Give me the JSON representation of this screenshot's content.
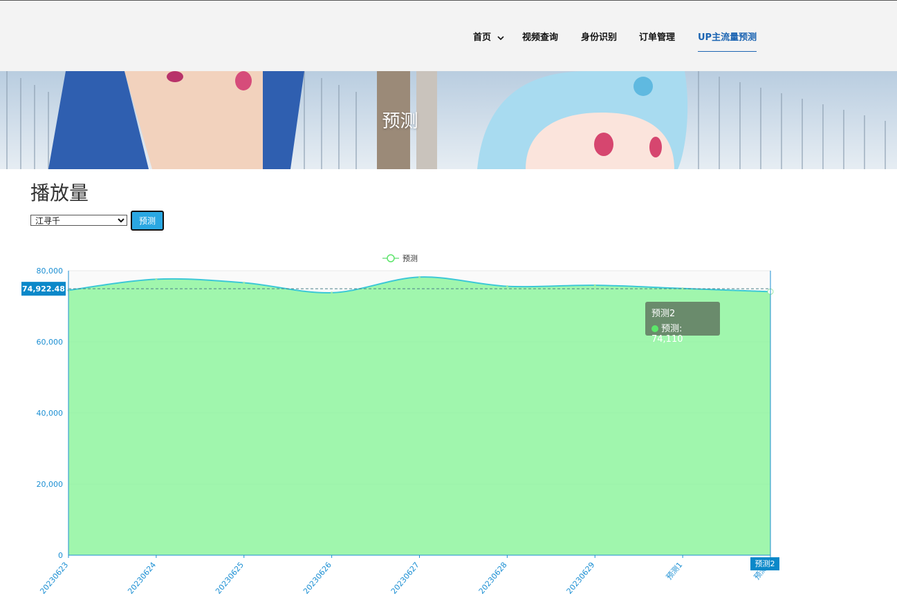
{
  "nav": {
    "items": [
      {
        "label": "首页",
        "has_dropdown": true
      },
      {
        "label": "视频查询"
      },
      {
        "label": "身份识别"
      },
      {
        "label": "订单管理"
      },
      {
        "label": "UP主流量预测",
        "active": true
      }
    ]
  },
  "banner": {
    "title": "预测"
  },
  "page": {
    "heading": "播放量"
  },
  "form": {
    "selected_up": "江寻千",
    "button_label": "预测"
  },
  "tooltip": {
    "title": "预测2",
    "series": "预测",
    "value_text": "74,110"
  },
  "colors": {
    "line": "#3cc8d6",
    "area": "#8ff59f",
    "axis": "#1c8fd3",
    "nav_active": "#1b64b2",
    "button": "#2aa7e2"
  },
  "chart_data": {
    "type": "area",
    "legend": [
      "预测"
    ],
    "legend_position": "top-center",
    "categories": [
      "20230623",
      "20230624",
      "20230625",
      "20230626",
      "20230627",
      "20230628",
      "20230629",
      "预测1",
      "预测2"
    ],
    "series": [
      {
        "name": "预测",
        "values": [
          74500,
          77600,
          76600,
          73800,
          78200,
          75600,
          75900,
          75000,
          74110
        ]
      }
    ],
    "ylim": [
      0,
      80000
    ],
    "yticks": [
      0,
      20000,
      40000,
      60000,
      80000
    ],
    "ytick_labels": [
      "0",
      "20,000",
      "40,000",
      "60,000",
      "80,000"
    ],
    "average": 74922.48,
    "average_label": "74,922.48",
    "highlight_category": "预测2",
    "grid": true
  }
}
